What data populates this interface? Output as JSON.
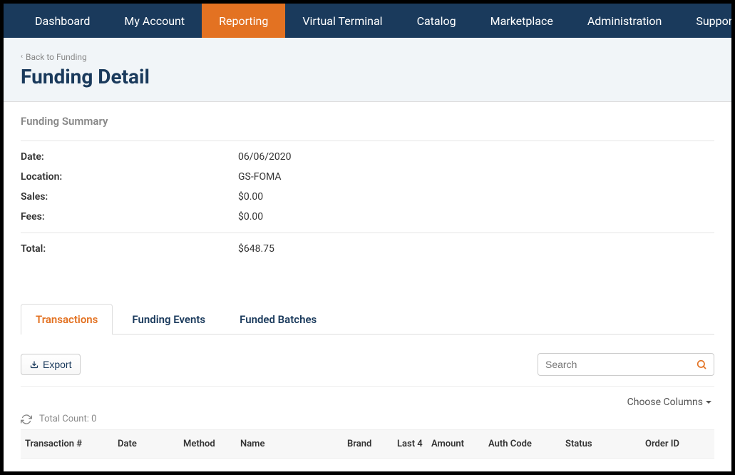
{
  "nav": {
    "items": [
      {
        "label": "Dashboard"
      },
      {
        "label": "My Account"
      },
      {
        "label": "Reporting"
      },
      {
        "label": "Virtual Terminal"
      },
      {
        "label": "Catalog"
      },
      {
        "label": "Marketplace"
      },
      {
        "label": "Administration"
      },
      {
        "label": "Support"
      }
    ],
    "activeIndex": 2
  },
  "header": {
    "back_label": "Back to Funding",
    "title": "Funding Detail"
  },
  "summary": {
    "title": "Funding Summary",
    "rows": [
      {
        "label": "Date:",
        "value": "06/06/2020"
      },
      {
        "label": "Location:",
        "value": "GS-FOMA"
      },
      {
        "label": "Sales:",
        "value": "$0.00"
      },
      {
        "label": "Fees:",
        "value": "$0.00"
      }
    ],
    "total": {
      "label": "Total:",
      "value": "$648.75"
    }
  },
  "tabs": {
    "items": [
      {
        "label": "Transactions"
      },
      {
        "label": "Funding Events"
      },
      {
        "label": "Funded Batches"
      }
    ],
    "activeIndex": 0
  },
  "toolbar": {
    "export_label": "Export",
    "search_placeholder": "Search",
    "choose_columns_label": "Choose Columns",
    "total_count_label": "Total Count: 0"
  },
  "table": {
    "columns": [
      "Transaction #",
      "Date",
      "Method",
      "Name",
      "Brand",
      "Last 4",
      "Amount",
      "Auth Code",
      "Status",
      "Order ID"
    ]
  }
}
